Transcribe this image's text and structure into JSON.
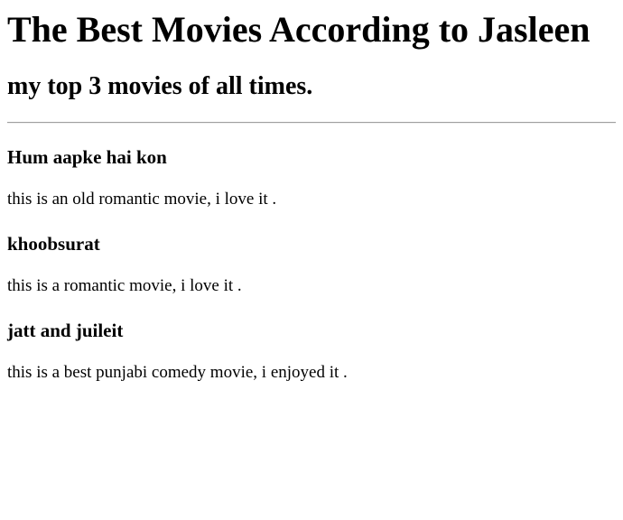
{
  "header": {
    "title": "The Best Movies According to Jasleen",
    "subtitle": "my top 3 movies of all times."
  },
  "movies": [
    {
      "title": "Hum aapke hai kon",
      "description": "this is an old romantic movie, i love it ."
    },
    {
      "title": "khoobsurat",
      "description": "this is a romantic movie, i love it ."
    },
    {
      "title": "jatt and juileit",
      "description": "this is a best punjabi comedy movie, i enjoyed it ."
    }
  ]
}
